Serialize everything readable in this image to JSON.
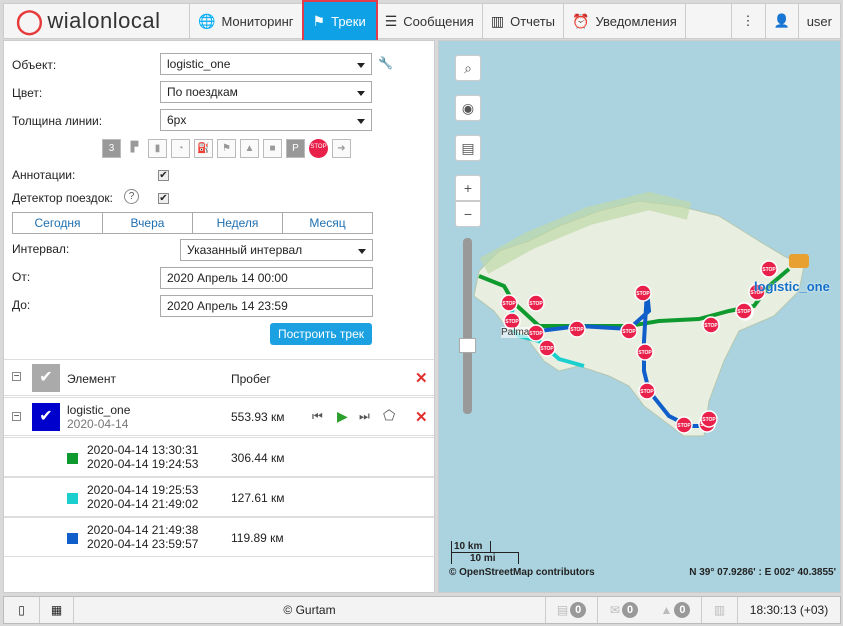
{
  "header": {
    "logo": "wialonlocal",
    "nav": [
      {
        "label": "Мониторинг",
        "icon": "globe-icon"
      },
      {
        "label": "Треки",
        "icon": "flag-icon",
        "active": true
      },
      {
        "label": "Сообщения",
        "icon": "document-icon"
      },
      {
        "label": "Отчеты",
        "icon": "report-icon"
      },
      {
        "label": "Уведомления",
        "icon": "alarm-icon"
      }
    ],
    "user": "user"
  },
  "form": {
    "object_label": "Объект:",
    "object_value": "logistic_one",
    "color_label": "Цвет:",
    "color_value": "По поездкам",
    "width_label": "Толщина линии:",
    "width_value": "6px",
    "annotations_label": "Аннотации:",
    "annotations_checked": true,
    "trip_label": "Детектор поездок:",
    "trip_checked": true,
    "tabs": [
      "Сегодня",
      "Вчера",
      "Неделя",
      "Месяц"
    ],
    "interval_label": "Интервал:",
    "interval_value": "Указанный интервал",
    "from_label": "От:",
    "from_value": "2020 Апрель 14 00:00",
    "to_label": "До:",
    "to_value": "2020 Апрель 14 23:59",
    "build_button": "Построить трек"
  },
  "table": {
    "col_element": "Элемент",
    "col_mileage": "Пробег",
    "unit": {
      "name": "logistic_one",
      "date": "2020-04-14",
      "mileage": "553.93 км"
    },
    "trips": [
      {
        "start": "2020-04-14 13:30:31",
        "end": "2020-04-14 19:24:53",
        "mileage": "306.44 км",
        "color": "#0e9a2e"
      },
      {
        "start": "2020-04-14 19:25:53",
        "end": "2020-04-14 21:49:02",
        "mileage": "127.61 км",
        "color": "#1ccfcf"
      },
      {
        "start": "2020-04-14 21:49:38",
        "end": "2020-04-14 23:59:57",
        "mileage": "119.89 км",
        "color": "#0f5ec9"
      }
    ]
  },
  "map": {
    "unit_label": "logistic_one",
    "city": "Palma",
    "scale_km": "10 km",
    "scale_mi": "10 mi",
    "attribution": "© OpenStreetMap contributors",
    "coords": "N 39° 07.9286' : E 002° 40.3855'",
    "stop": "STOP"
  },
  "footer": {
    "copyright": "© Gurtam",
    "counts": [
      "0",
      "0",
      "0"
    ],
    "time": "18:30:13 (+03)"
  }
}
